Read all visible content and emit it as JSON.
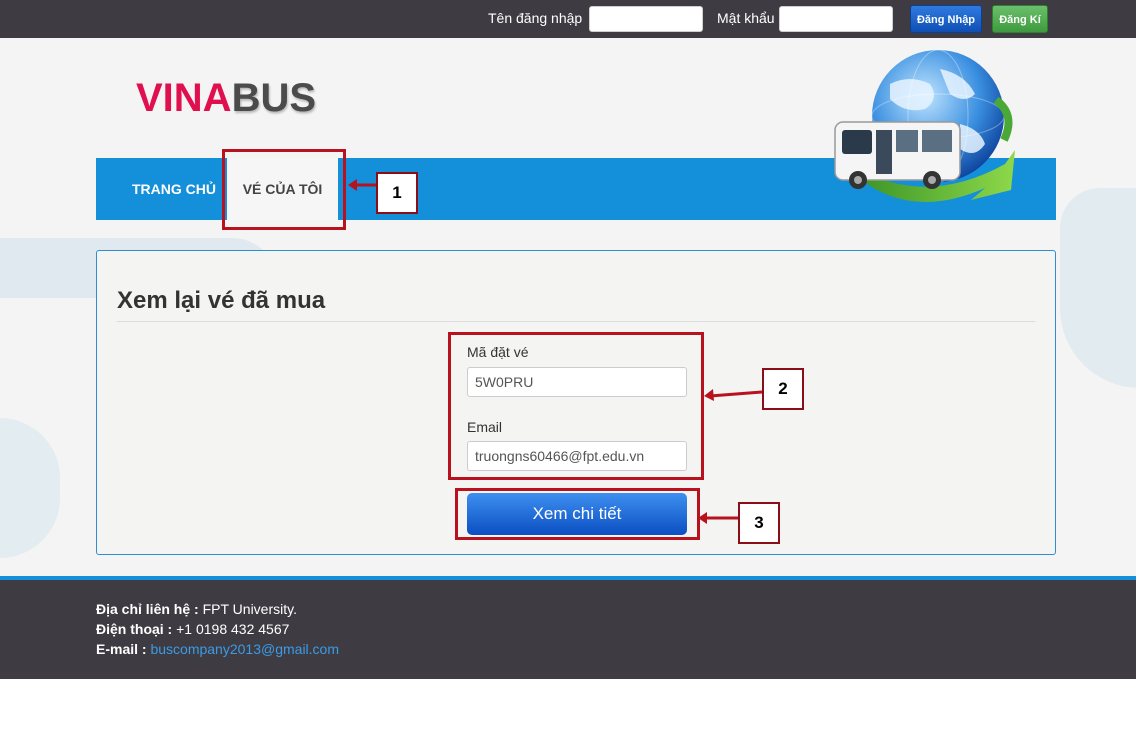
{
  "topbar": {
    "username_label": "Tên đăng nhập",
    "username_value": "",
    "password_label": "Mật khẩu",
    "password_value": "",
    "login_button": "Đăng Nhập",
    "register_button": "Đăng Kí"
  },
  "logo": {
    "part1": "VINA",
    "part2": "BUS"
  },
  "nav": {
    "home": "TRANG CHỦ",
    "my_tickets": "VÉ CỦA TÔI"
  },
  "form": {
    "title": "Xem lại vé đã mua",
    "code_label": "Mã đặt vé",
    "code_value": "5W0PRU",
    "email_label": "Email",
    "email_value": "truongns60466@fpt.edu.vn",
    "submit": "Xem chi tiết"
  },
  "annotations": [
    "1",
    "2",
    "3"
  ],
  "footer": {
    "address_label": "Địa chỉ liên hệ :",
    "address_value": " FPT University.",
    "phone_label": "Điện thoại :",
    "phone_value": " +1 0198 432 4567",
    "email_label": "E-mail :",
    "email_value": "buscompany2013@gmail.com"
  },
  "colors": {
    "topbar": "#3e3c42",
    "nav": "#148fd9",
    "logo_red": "#e0104e",
    "annotation_red": "#b8121e",
    "submit_blue": "#0b4fc2"
  }
}
